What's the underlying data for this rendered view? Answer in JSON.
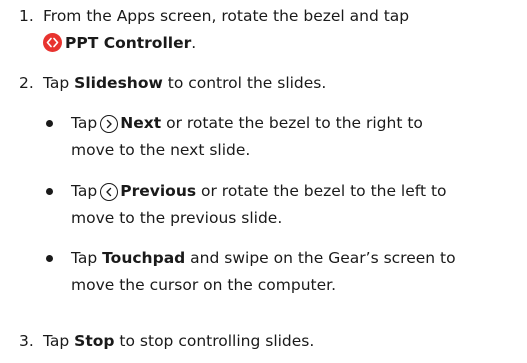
{
  "steps": [
    {
      "number": "1.",
      "line1": "From the Apps screen, rotate the bezel and tap",
      "app_label": "PPT Controller",
      "suffix": "."
    },
    {
      "number": "2.",
      "pre": "Tap ",
      "bold": "Slideshow",
      "post": " to control the slides."
    },
    {
      "number": "3.",
      "pre": "Tap ",
      "bold": "Stop",
      "post": " to stop controlling slides."
    }
  ],
  "bullets": [
    {
      "pre": "Tap",
      "icon": "chevron-right-circle-icon",
      "bold": "Next",
      "line1_post": " or rotate the bezel to the right to",
      "line2": "move to the next slide."
    },
    {
      "pre": "Tap",
      "icon": "chevron-left-circle-icon",
      "bold": "Previous",
      "line1_post": " or rotate the bezel to the left to",
      "line2": "move to the previous slide."
    },
    {
      "pre": "Tap ",
      "bold": "Touchpad",
      "line1_post": " and swipe on the Gear’s screen to",
      "line2": "move the cursor on the computer."
    }
  ],
  "colors": {
    "app_icon": "#e8332f",
    "text": "#1a1a1a"
  }
}
